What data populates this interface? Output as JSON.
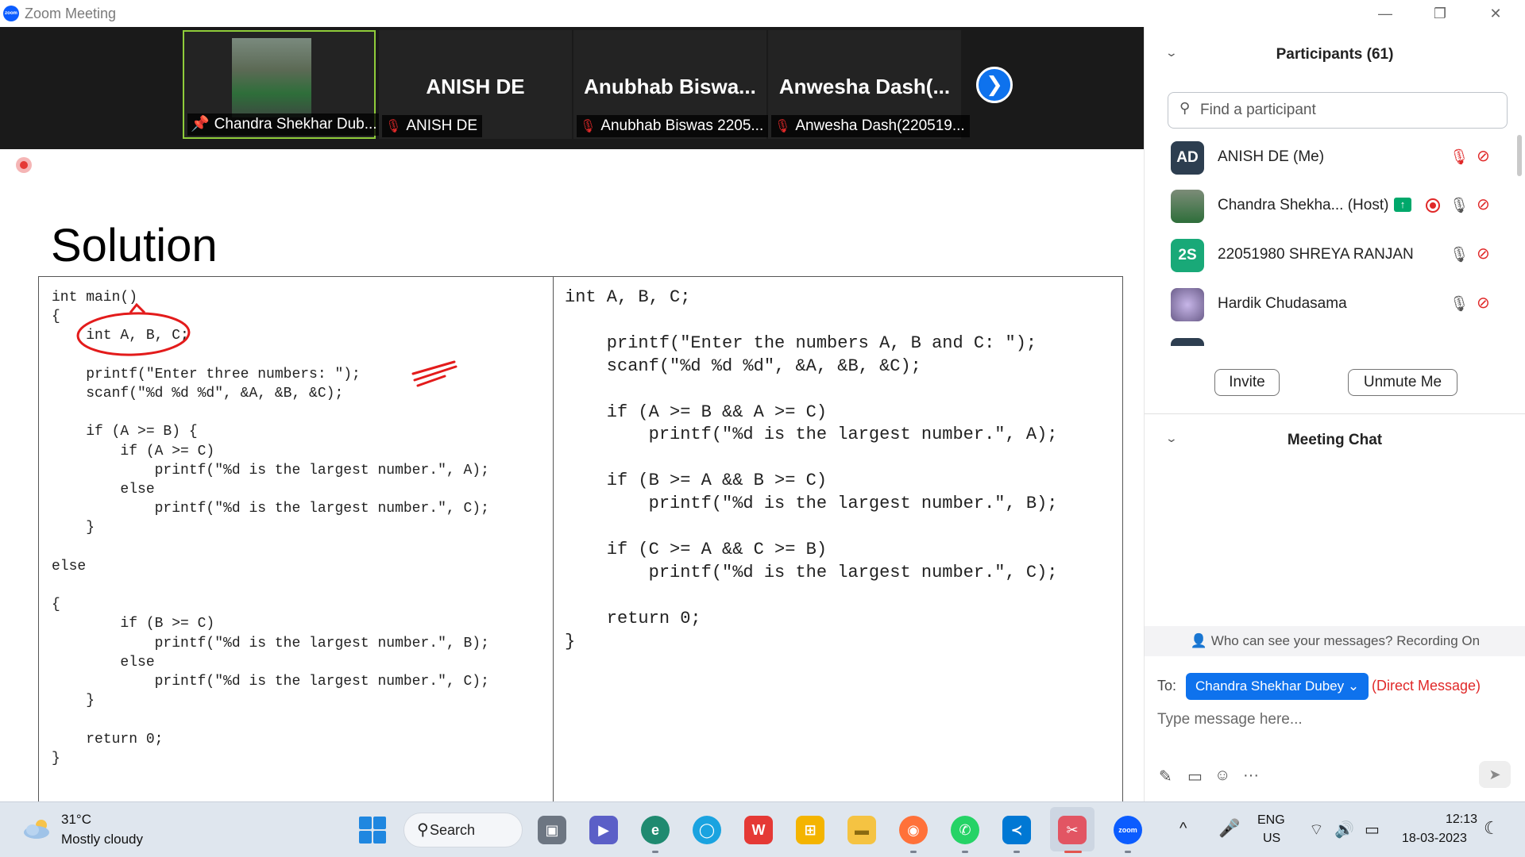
{
  "window": {
    "icon_text": "zoom",
    "title": "Zoom Meeting",
    "minimize": "—",
    "restore": "❐",
    "close": "✕"
  },
  "video_strip": {
    "tiles": [
      {
        "big_name": "",
        "label": "Chandra Shekhar Dub...",
        "pinned": true
      },
      {
        "big_name": "ANISH DE",
        "label": "ANISH DE",
        "muted": true
      },
      {
        "big_name": "Anubhab  Biswa...",
        "label": "Anubhab Biswas 2205...",
        "muted": true
      },
      {
        "big_name": "Anwesha  Dash(...",
        "label": "Anwesha Dash(220519...",
        "muted": true
      }
    ],
    "next_icon": "❯"
  },
  "slide": {
    "title": "Solution",
    "code_left": "int main()\n{\n    int A, B, C;\n\n    printf(\"Enter three numbers: \");\n    scanf(\"%d %d %d\", &A, &B, &C);\n\n    if (A >= B) {\n        if (A >= C)\n            printf(\"%d is the largest number.\", A);\n        else\n            printf(\"%d is the largest number.\", C);\n    }\n\nelse\n\n{\n        if (B >= C)\n            printf(\"%d is the largest number.\", B);\n        else\n            printf(\"%d is the largest number.\", C);\n    }\n\n    return 0;\n}",
    "code_right": "int A, B, C;\n\n    printf(\"Enter the numbers A, B and C: \");\n    scanf(\"%d %d %d\", &A, &B, &C);\n\n    if (A >= B && A >= C)\n        printf(\"%d is the largest number.\", A);\n\n    if (B >= A && B >= C)\n        printf(\"%d is the largest number.\", B);\n\n    if (C >= A && C >= B)\n        printf(\"%d is the largest number.\", C);\n\n    return 0;\n}"
  },
  "participants": {
    "title": "Participants (61)",
    "collapse_icon": "⌄",
    "search_placeholder": "Find a participant",
    "search_icon": "⚲",
    "list": [
      {
        "initials": "AD",
        "avatar_color": "#2d3e50",
        "name": "ANISH DE (Me)",
        "mic": "muted"
      },
      {
        "initials": "",
        "avatar_color": "#4a6a4a",
        "name": "Chandra Shekha... (Host)",
        "host_badge": "↑",
        "recording": true,
        "mic": "on"
      },
      {
        "initials": "2S",
        "avatar_color": "#19a978",
        "name": "22051980 SHREYA RANJAN",
        "mic": "on"
      },
      {
        "initials": "",
        "avatar_color": "#6b5d8a",
        "name": "Hardik Chudasama",
        "mic": "on"
      }
    ],
    "mic_on_icon": "🎙",
    "mic_off_icon": "🎙",
    "video_off_icon": "⊘",
    "invite": "Invite",
    "unmute": "Unmute Me"
  },
  "chat": {
    "title": "Meeting Chat",
    "notice": "Who can see your messages? Recording On",
    "to_label": "To:",
    "recipient": "Chandra Shekhar Dubey",
    "recipient_caret": "⌄",
    "dm_label": "(Direct Message)",
    "placeholder": "Type message here...",
    "tools": [
      "✎",
      "▭",
      "☺",
      "···"
    ],
    "send_icon": "➤"
  },
  "taskbar": {
    "temp": "31°C",
    "weather": "Mostly cloudy",
    "search": "Search",
    "search_icon": "⚲",
    "apps": [
      {
        "name": "task-view",
        "glyph": "▣",
        "color": "#6d7682"
      },
      {
        "name": "meet",
        "glyph": "▶",
        "color": "#5b5fc7"
      },
      {
        "name": "edge",
        "glyph": "e",
        "color": "#1f8a70"
      },
      {
        "name": "cortana",
        "glyph": "◯",
        "color": "#1aa3e0"
      },
      {
        "name": "wps",
        "glyph": "W",
        "color": "#e53935"
      },
      {
        "name": "store",
        "glyph": "⊞",
        "color": "#f4b400"
      },
      {
        "name": "files",
        "glyph": "▬",
        "color": "#f5c342"
      },
      {
        "name": "firefox",
        "glyph": "◉",
        "color": "#ff7139"
      },
      {
        "name": "whatsapp",
        "glyph": "✆",
        "color": "#25d366"
      },
      {
        "name": "vscode",
        "glyph": "≺",
        "color": "#0078d4"
      },
      {
        "name": "snip",
        "glyph": "✂",
        "color": "#e25563"
      },
      {
        "name": "zoom",
        "glyph": "zoom",
        "color": "#0b5cff"
      }
    ],
    "chevron": "^",
    "mic_icon": "🎤",
    "lang_1": "ENG",
    "lang_2": "US",
    "wifi": "⌔",
    "volume": "🔊",
    "battery": "▭",
    "time": "12:13",
    "date": "18-03-2023",
    "moon": "☾"
  },
  "colors": {
    "zoom_blue": "#0e72ed",
    "muted_red": "#e02828",
    "active_speaker_border": "#8fcc3a",
    "host_badge": "#00a86b"
  }
}
